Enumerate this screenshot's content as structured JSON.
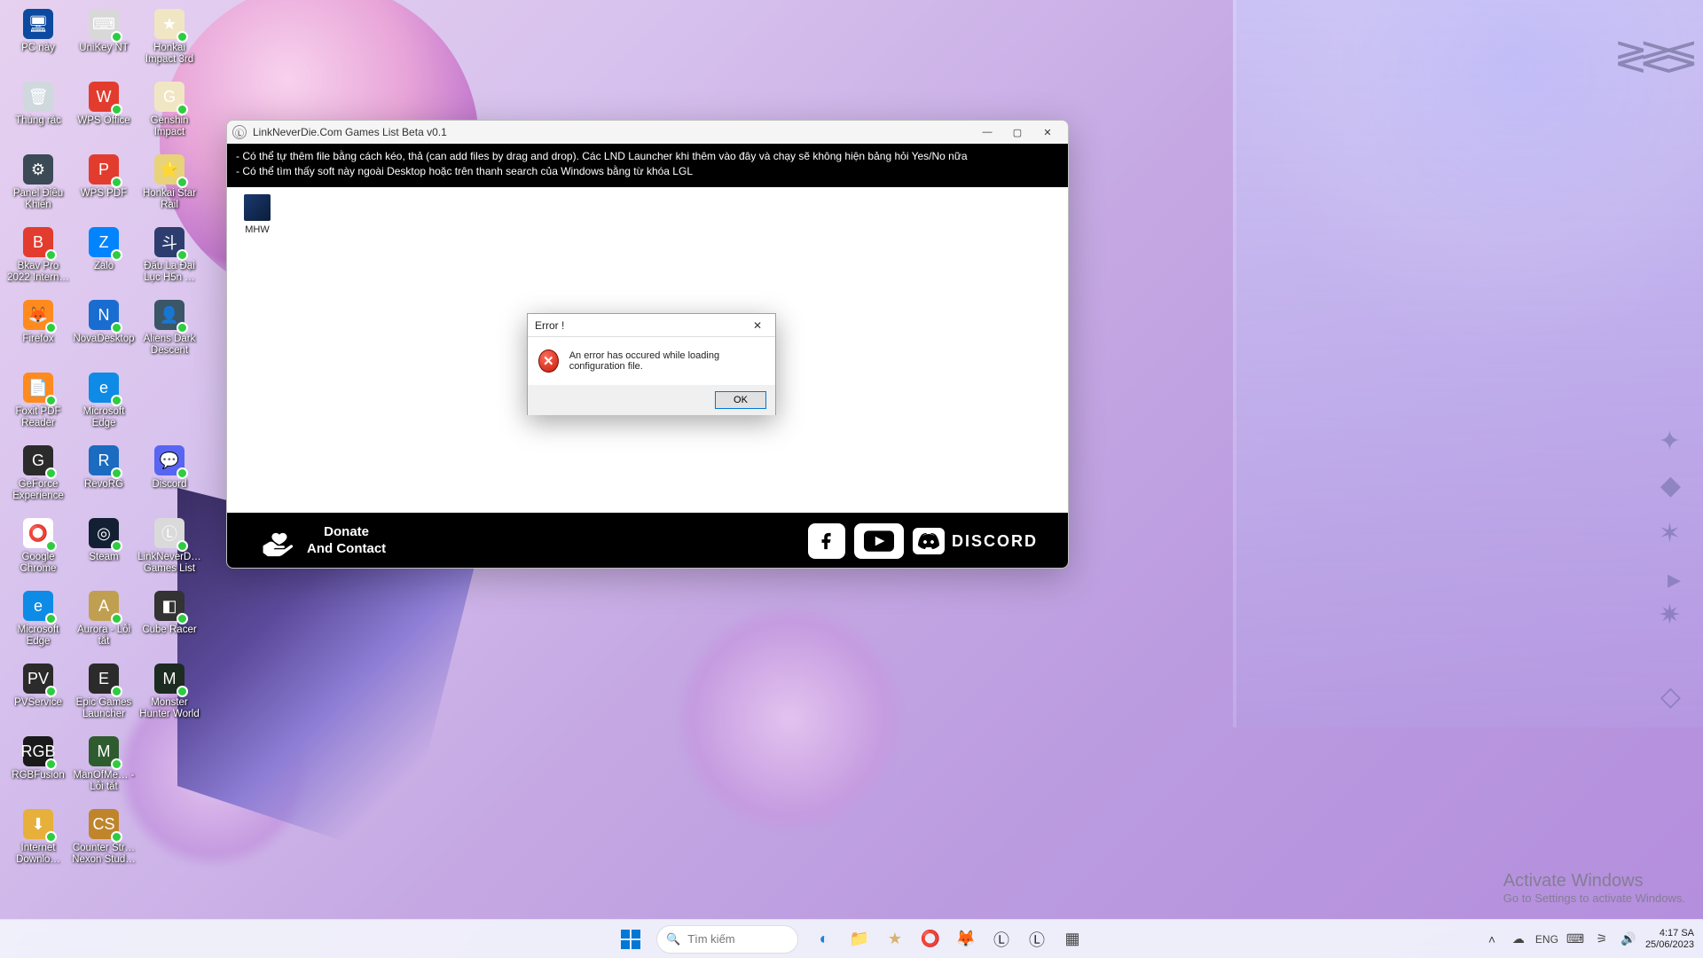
{
  "desktop_icons": [
    {
      "label": "PC này",
      "bg": "#0b4aa0",
      "glyph": "🖥"
    },
    {
      "label": "UniKey NT",
      "bg": "#d8d8d8",
      "glyph": "⌨",
      "badge": true
    },
    {
      "label": "Honkai Impact 3rd",
      "bg": "#f1e6c4",
      "glyph": "★",
      "badge": true
    },
    {
      "label": "Thùng rác",
      "bg": "#cfd8dc",
      "glyph": "🗑"
    },
    {
      "label": "WPS Office",
      "bg": "#e23c2f",
      "glyph": "W",
      "badge": true
    },
    {
      "label": "Genshin Impact",
      "bg": "#f1e6c4",
      "glyph": "G",
      "badge": true
    },
    {
      "label": "Panel Điều Khiển",
      "bg": "#3b4a55",
      "glyph": "⚙"
    },
    {
      "label": "WPS PDF",
      "bg": "#e23c2f",
      "glyph": "P",
      "badge": true
    },
    {
      "label": "Honkai Star Rail",
      "bg": "#e8d27a",
      "glyph": "⭐",
      "badge": true
    },
    {
      "label": "Bkav Pro 2022 Intern…",
      "bg": "#e23c2f",
      "glyph": "B",
      "badge": true
    },
    {
      "label": "Zalo",
      "bg": "#0384ff",
      "glyph": "Z",
      "badge": true
    },
    {
      "label": "Đấu La Đại Lục H5n …",
      "bg": "#2d3d6e",
      "glyph": "斗",
      "badge": true
    },
    {
      "label": "Firefox",
      "bg": "#ff8a1e",
      "glyph": "🦊",
      "badge": true
    },
    {
      "label": "NovaDesktop",
      "bg": "#1a6dd0",
      "glyph": "N",
      "badge": true
    },
    {
      "label": "Aliens Dark Descent",
      "bg": "#3b5666",
      "glyph": "👤",
      "badge": true
    },
    {
      "label": "Foxit PDF Reader",
      "bg": "#ff8a1e",
      "glyph": "📄",
      "badge": true
    },
    {
      "label": "Microsoft Edge",
      "bg": "#0d8be6",
      "glyph": "e",
      "badge": true
    },
    {
      "label": "",
      "bg": "transparent",
      "glyph": ""
    },
    {
      "label": "GeForce Experience",
      "bg": "#2b2b2b",
      "glyph": "G",
      "badge": true
    },
    {
      "label": "RevoRG",
      "bg": "#1b6bc0",
      "glyph": "R",
      "badge": true
    },
    {
      "label": "Discord",
      "bg": "#5865f2",
      "glyph": "💬",
      "badge": true
    },
    {
      "label": "Google Chrome",
      "bg": "#ffffff",
      "glyph": "⭕",
      "badge": true
    },
    {
      "label": "Steam",
      "bg": "#132033",
      "glyph": "◎",
      "badge": true
    },
    {
      "label": "LinkNeverD… Games List",
      "bg": "#dadada",
      "glyph": "Ⓛ",
      "badge": true
    },
    {
      "label": "Microsoft Edge",
      "bg": "#0d8be6",
      "glyph": "e",
      "badge": true
    },
    {
      "label": "Aurora - Lỗi tắt",
      "bg": "#c0a050",
      "glyph": "A",
      "badge": true
    },
    {
      "label": "Cube Racer",
      "bg": "#333",
      "glyph": "◧",
      "badge": true
    },
    {
      "label": "PVService",
      "bg": "#2b2b2b",
      "glyph": "PV",
      "badge": true
    },
    {
      "label": "Epic Games Launcher",
      "bg": "#2b2b2b",
      "glyph": "E",
      "badge": true
    },
    {
      "label": "Monster Hunter World",
      "bg": "#1c2c20",
      "glyph": "M",
      "badge": true
    },
    {
      "label": "RGBFusion",
      "bg": "#1a1a1a",
      "glyph": "RGB",
      "badge": true
    },
    {
      "label": "ManOfMe… - Lỗi tắt",
      "bg": "#2f5c2f",
      "glyph": "M",
      "badge": true
    },
    {
      "label": "",
      "bg": "transparent",
      "glyph": ""
    },
    {
      "label": "Internet Downlo…",
      "bg": "#e6b03a",
      "glyph": "⬇",
      "badge": true
    },
    {
      "label": "Counter Str… Nexon Stud…",
      "bg": "#c0852a",
      "glyph": "CS",
      "badge": true
    }
  ],
  "app": {
    "title": "LinkNeverDie.Com Games List Beta v0.1",
    "info_line1": "- Có thể tự thêm file bằng cách kéo, thả (can add files by drag and drop). Các LND Launcher khi thêm vào đây và chạy sẽ không hiện bảng hỏi Yes/No nữa",
    "info_line2": "- Có thể tìm thấy soft này ngoài Desktop hoặc trên thanh search của Windows bằng từ khóa LGL",
    "games": [
      {
        "label": "MHW"
      }
    ],
    "footer": {
      "donate_line1": "Donate",
      "donate_line2": "And Contact",
      "discord_label": "DISCORD"
    }
  },
  "error_dialog": {
    "title": "Error !",
    "message": "An error has occured while loading configuration file.",
    "ok_label": "OK"
  },
  "activate": {
    "line1": "Activate Windows",
    "line2": "Go to Settings to activate Windows."
  },
  "taskbar": {
    "search_placeholder": "Tìm kiếm",
    "pinned": [
      {
        "name": "start",
        "glyph": "⊞",
        "color": "#0078d4"
      },
      {
        "name": "copilot",
        "glyph": "◐",
        "color": "#1a84d6"
      },
      {
        "name": "explorer",
        "glyph": "📁",
        "color": "#f2b84b"
      },
      {
        "name": "honkai",
        "glyph": "★",
        "color": "#d7b46a"
      },
      {
        "name": "chrome",
        "glyph": "⭕",
        "color": "#ea4335"
      },
      {
        "name": "firefox",
        "glyph": "🦊",
        "color": "#ff8a1e"
      },
      {
        "name": "lnd1",
        "glyph": "Ⓛ",
        "color": "#333"
      },
      {
        "name": "lnd2",
        "glyph": "Ⓛ",
        "color": "#333"
      },
      {
        "name": "app",
        "glyph": "▦",
        "color": "#444"
      }
    ],
    "tray": {
      "chevron": "˄",
      "weather": "☁",
      "lang": "ENG",
      "net": "⌨",
      "wifi": "⚞",
      "vol": "🔊",
      "time": "4:17 SA",
      "date": "25/06/2023"
    }
  }
}
